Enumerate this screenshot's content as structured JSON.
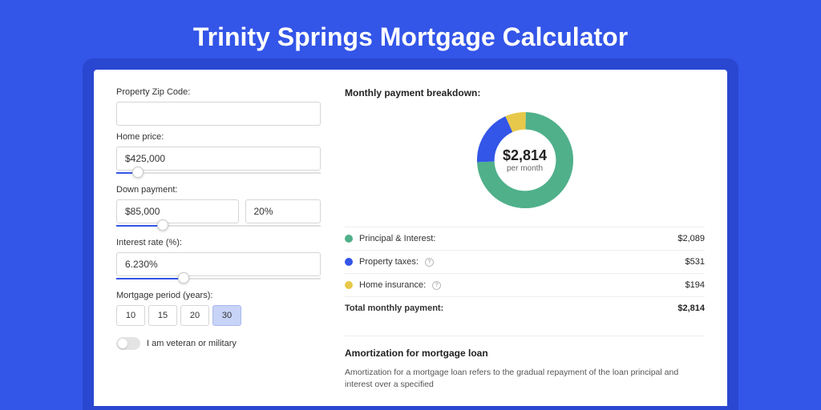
{
  "title": "Trinity Springs Mortgage Calculator",
  "form": {
    "zip_label": "Property Zip Code:",
    "zip_value": "",
    "home_price_label": "Home price:",
    "home_price_value": "$425,000",
    "down_payment_label": "Down payment:",
    "down_payment_value": "$85,000",
    "down_payment_pct": "20%",
    "interest_label": "Interest rate (%):",
    "interest_value": "6.230%",
    "period_label": "Mortgage period (years):",
    "periods": [
      "10",
      "15",
      "20",
      "30"
    ],
    "period_selected": "30",
    "veteran_label": "I am veteran or military"
  },
  "breakdown": {
    "title": "Monthly payment breakdown:",
    "donut_amount": "$2,814",
    "donut_period": "per month",
    "items": [
      {
        "label": "Principal & Interest:",
        "value": "$2,089",
        "color": "green"
      },
      {
        "label": "Property taxes:",
        "value": "$531",
        "color": "blue",
        "info": true
      },
      {
        "label": "Home insurance:",
        "value": "$194",
        "color": "yellow",
        "info": true
      }
    ],
    "total_label": "Total monthly payment:",
    "total_value": "$2,814"
  },
  "amortization": {
    "title": "Amortization for mortgage loan",
    "text": "Amortization for a mortgage loan refers to the gradual repayment of the loan principal and interest over a specified"
  },
  "chart_data": {
    "type": "pie",
    "title": "Monthly payment breakdown",
    "series": [
      {
        "name": "Principal & Interest",
        "value": 2089,
        "color": "#4fb08a"
      },
      {
        "name": "Property taxes",
        "value": 531,
        "color": "#3355e8"
      },
      {
        "name": "Home insurance",
        "value": 194,
        "color": "#e8c84a"
      }
    ],
    "total": 2814
  }
}
